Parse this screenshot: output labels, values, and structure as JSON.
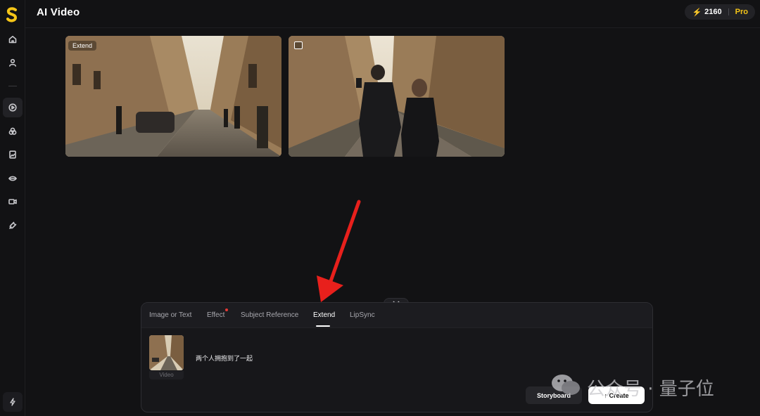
{
  "header": {
    "title": "AI Video",
    "credits": "2160",
    "plan": "Pro"
  },
  "sidebar": {
    "items": [
      {
        "name": "home-icon"
      },
      {
        "name": "user-icon"
      },
      {
        "name": "video-play-icon",
        "active": true
      },
      {
        "name": "effects-icon"
      },
      {
        "name": "image-file-icon"
      },
      {
        "name": "lips-icon"
      },
      {
        "name": "camera-icon"
      },
      {
        "name": "wrench-icon"
      }
    ],
    "bottom": "lightning-icon"
  },
  "cards": [
    {
      "badge": "Extend"
    },
    {
      "badge_icon": "image-icon"
    }
  ],
  "panel": {
    "tabs": [
      {
        "label": "Image or Text"
      },
      {
        "label": "Effect"
      },
      {
        "label": "Subject Reference"
      },
      {
        "label": "Extend",
        "active": true
      },
      {
        "label": "LipSync"
      }
    ],
    "thumb_label": "Video",
    "prompt": "两个人拥抱到了一起",
    "storyboard_label": "Storyboard",
    "create_label": "↑ Create"
  },
  "watermark": "公众号 · 量子位",
  "colors": {
    "background": "#121214",
    "accent": "#f5c518",
    "arrow": "#e8201c"
  }
}
